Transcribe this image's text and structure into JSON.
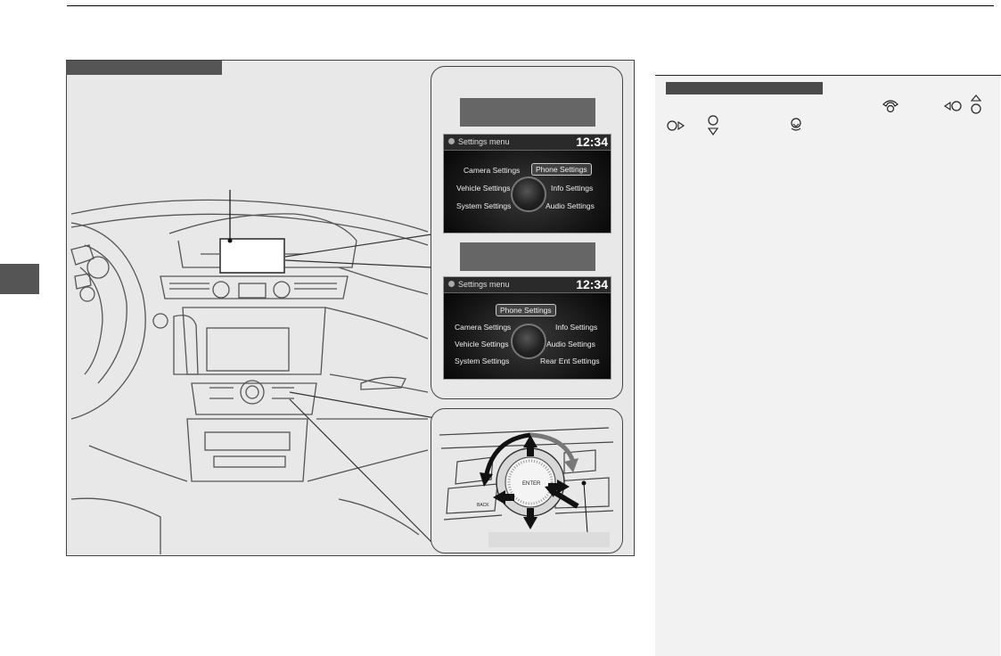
{
  "settings_screen_1": {
    "title": "Settings menu",
    "time": "12:34",
    "items": [
      "Camera Settings",
      "Phone Settings",
      "Vehicle Settings",
      "Info Settings",
      "System Settings",
      "Audio Settings"
    ],
    "selected": "Phone Settings"
  },
  "settings_screen_2": {
    "title": "Settings menu",
    "time": "12:34",
    "items": [
      "Phone Settings",
      "Camera Settings",
      "Info Settings",
      "Vehicle Settings",
      "Audio Settings",
      "System Settings",
      "Rear Ent Settings"
    ],
    "selected": "Phone Settings"
  },
  "knob_labels": {
    "enter": "ENTER",
    "back": "BACK"
  },
  "sidebar_icons": [
    "phone-icon",
    "left-icon",
    "up-icon",
    "right-icon",
    "down-icon",
    "press-icon"
  ],
  "colors": {
    "figure_bg": "#e8e8e8",
    "label_bar": "#555555",
    "screen_bg": "#151515",
    "sidebar_bg": "#f2f2f2"
  }
}
